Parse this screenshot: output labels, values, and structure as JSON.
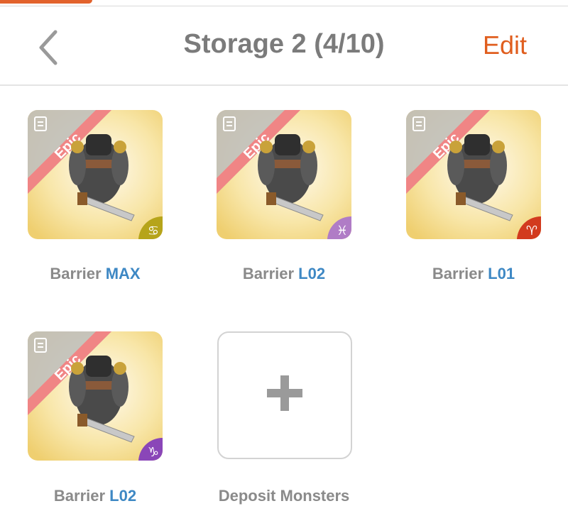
{
  "header": {
    "title": "Storage 2 (4/10)",
    "edit_label": "Edit"
  },
  "monsters": [
    {
      "name": "Barrier",
      "level": "MAX",
      "rarity": "Epic",
      "element_icon": "cancer-icon",
      "element_glyph": "♋",
      "element_color": "#b6a41a"
    },
    {
      "name": "Barrier",
      "level": "L02",
      "rarity": "Epic",
      "element_icon": "pisces-icon",
      "element_glyph": "♓",
      "element_color": "#b07cc6"
    },
    {
      "name": "Barrier",
      "level": "L01",
      "rarity": "Epic",
      "element_icon": "aries-icon",
      "element_glyph": "♈",
      "element_color": "#d23a1e"
    },
    {
      "name": "Barrier",
      "level": "L02",
      "rarity": "Epic",
      "element_icon": "capricorn-icon",
      "element_glyph": "♑",
      "element_color": "#8a46b8"
    }
  ],
  "deposit": {
    "label": "Deposit Monsters"
  },
  "colors": {
    "accent": "#e05e1e",
    "level_text": "#3e88c4",
    "epic_ribbon": "#f07a7a"
  }
}
